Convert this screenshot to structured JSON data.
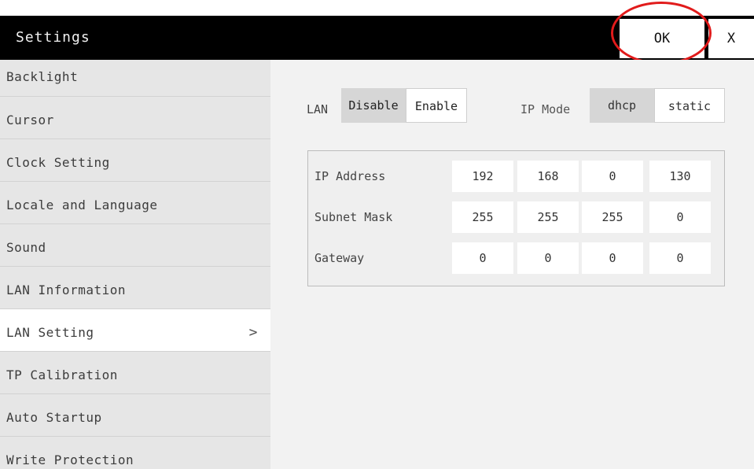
{
  "window": {
    "title": "Settings",
    "ok_label": "OK",
    "close_label": "X",
    "highlight_color": "#e11b1b"
  },
  "sidebar": {
    "items": [
      {
        "label": "Backlight"
      },
      {
        "label": "Cursor"
      },
      {
        "label": "Clock Setting"
      },
      {
        "label": "Locale and Language"
      },
      {
        "label": "Sound"
      },
      {
        "label": "LAN Information"
      },
      {
        "label": "LAN Setting",
        "active": true,
        "chevron": ">"
      },
      {
        "label": "TP Calibration"
      },
      {
        "label": "Auto Startup"
      },
      {
        "label": "Write Protection"
      }
    ]
  },
  "lan": {
    "label": "LAN",
    "options": [
      "Disable",
      "Enable"
    ],
    "selected": "Disable"
  },
  "ip_mode": {
    "label": "IP Mode",
    "options": [
      "dhcp",
      "static"
    ],
    "selected": "dhcp"
  },
  "ip_table": {
    "rows": [
      {
        "label": "IP Address",
        "values": [
          "192",
          "168",
          "0",
          "130"
        ]
      },
      {
        "label": "Subnet Mask",
        "values": [
          "255",
          "255",
          "255",
          "0"
        ]
      },
      {
        "label": "Gateway",
        "values": [
          "0",
          "0",
          "0",
          "0"
        ]
      }
    ]
  }
}
